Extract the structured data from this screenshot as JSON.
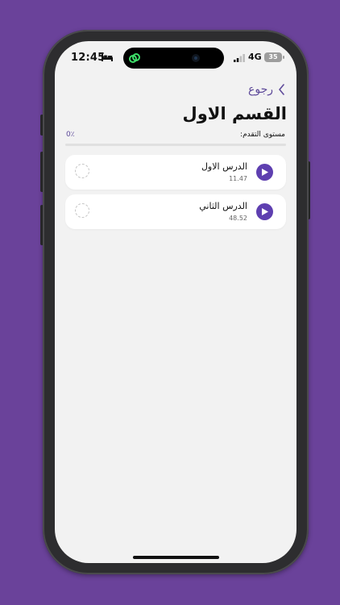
{
  "status_bar": {
    "time": "12:45",
    "network": "4G",
    "battery": "35"
  },
  "header": {
    "back_label": "رجوع",
    "title": "القسم الاول"
  },
  "progress": {
    "label": "مستوى التقدم:",
    "value_text": "0٪",
    "fraction": 0
  },
  "lessons": [
    {
      "title": "الدرس الاول",
      "duration": "11.47"
    },
    {
      "title": "الدرس الثاني",
      "duration": "48.52"
    }
  ],
  "colors": {
    "background": "#6a429a",
    "screen": "#f2f2f2",
    "accent": "#5e3fb0",
    "back_text": "#5e4a9a"
  },
  "icons": {
    "back": "chevron-left-icon",
    "play": "play-icon",
    "status": "dashed-circle-icon",
    "sleep": "bed-icon",
    "signal": "signal-icon"
  }
}
